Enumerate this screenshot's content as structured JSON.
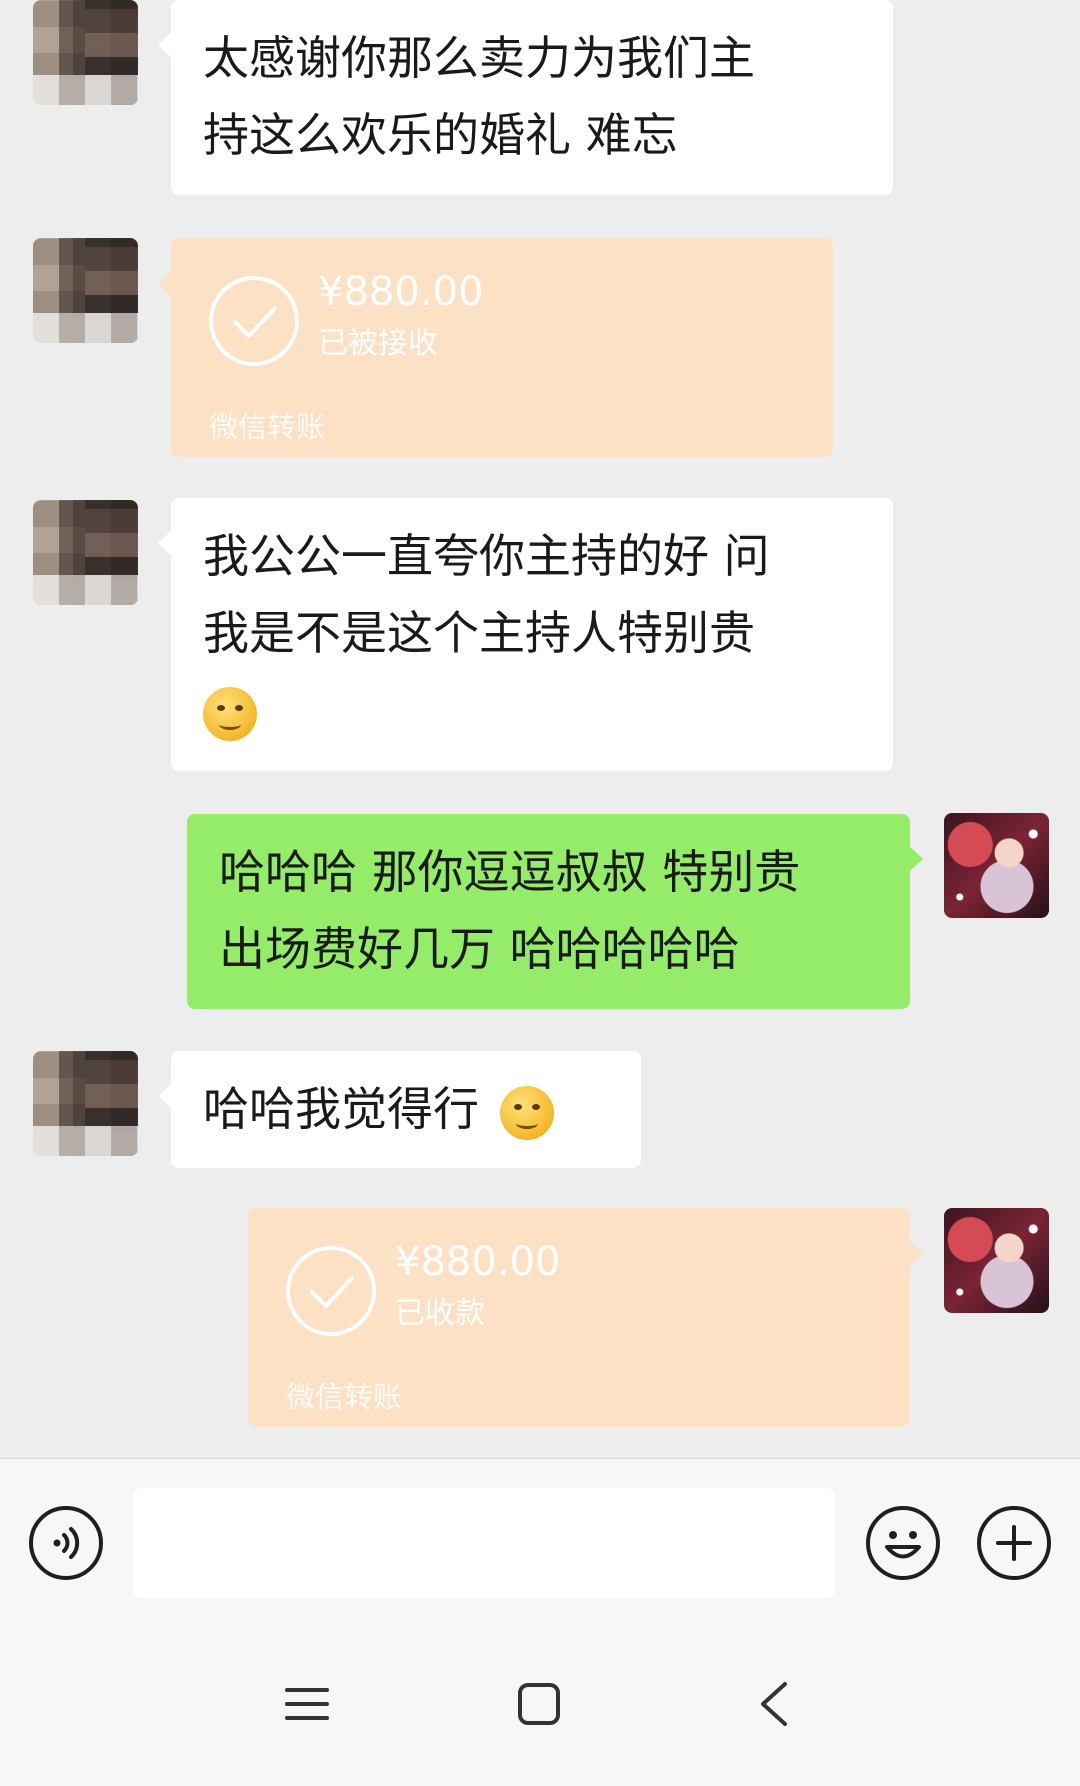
{
  "messages": {
    "m1": {
      "sender": "contact",
      "text_line1": "太感谢你那么卖力为我们主",
      "text_line2": "持这么欢乐的婚礼 难忘"
    },
    "m2": {
      "sender": "contact",
      "type": "transfer",
      "amount": "¥880.00",
      "status": "已被接收",
      "label": "微信转账"
    },
    "m3": {
      "sender": "contact",
      "text_line1": "我公公一直夸你主持的好 问",
      "text_line2": "我是不是这个主持人特别贵",
      "emoji": "hand-over-mouth-emoji"
    },
    "m4": {
      "sender": "me",
      "text_line1": "哈哈哈 那你逗逗叔叔 特别贵",
      "text_line2": "出场费好几万 哈哈哈哈哈"
    },
    "m5": {
      "sender": "contact",
      "text": "哈哈我觉得行",
      "emoji": "smirk-thinking-emoji"
    },
    "m6": {
      "sender": "me",
      "type": "transfer",
      "amount": "¥880.00",
      "status": "已收款",
      "label": "微信转账"
    }
  },
  "input_bar": {
    "voice_icon": "voice-input-icon",
    "emoji_icon": "emoji-icon",
    "more_icon": "plus-icon",
    "input_value": ""
  },
  "nav_bar": {
    "menu_icon": "menu-icon",
    "home_icon": "home-icon",
    "back_icon": "back-icon"
  },
  "colors": {
    "background": "#ededed",
    "incoming_bubble": "#ffffff",
    "outgoing_bubble": "#95ec69",
    "transfer_bubble": "#fde1c4"
  }
}
